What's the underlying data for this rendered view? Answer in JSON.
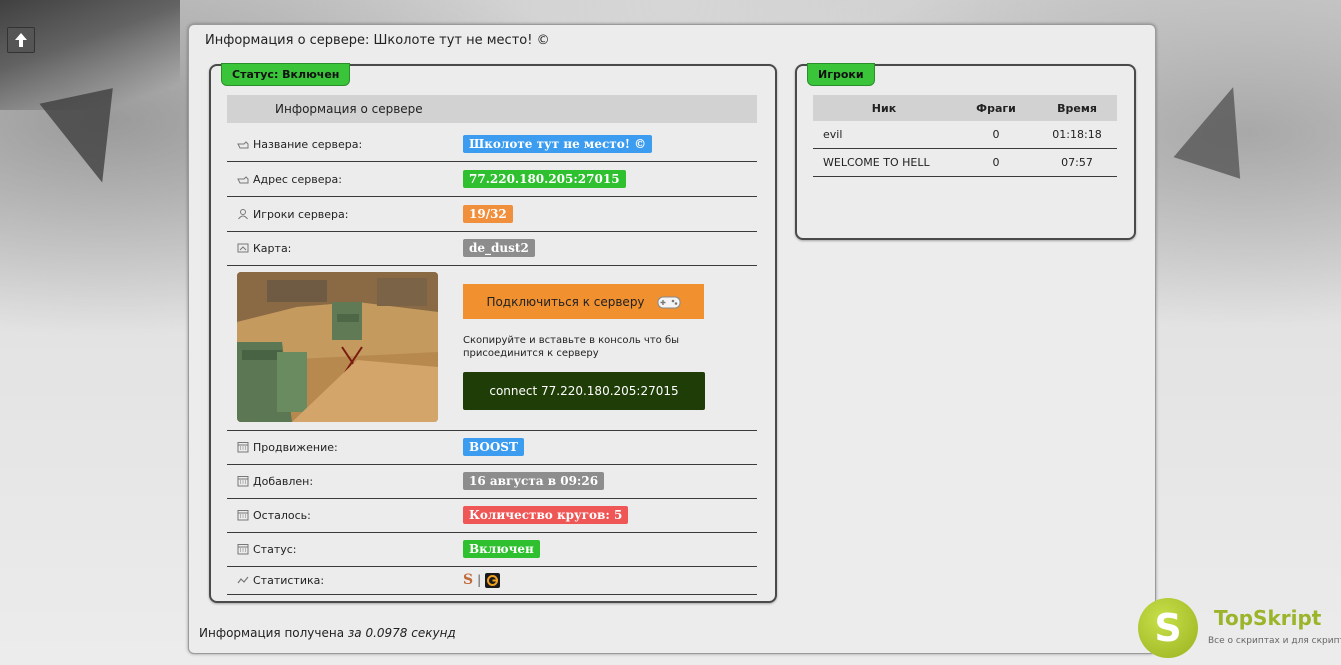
{
  "page_title": "Информация о сервере: Школоте тут не место! ©",
  "status_tab": "Статус: Включен",
  "players_tab": "Игроки",
  "info_header": "Информация о сервере",
  "rows": {
    "name": {
      "label": "Название сервера:",
      "value": "Школоте тут не место! ©"
    },
    "address": {
      "label": "Адрес сервера:",
      "value": "77.220.180.205:27015"
    },
    "players": {
      "label": "Игроки сервера:",
      "value": "19/32"
    },
    "map": {
      "label": "Карта:",
      "value": "de_dust2"
    },
    "promotion": {
      "label": "Продвижение:",
      "value": "BOOST"
    },
    "added": {
      "label": "Добавлен:",
      "value": "16 августа в 09:26"
    },
    "remaining": {
      "label": "Осталось:",
      "value": "Количество кругов: 5"
    },
    "status": {
      "label": "Статус:",
      "value": "Включен"
    },
    "stats": {
      "label": "Статистика:",
      "s_label": "S",
      "separator": "|"
    }
  },
  "connect": {
    "button_label": "Подключиться к серверу",
    "hint": "Скопируйте и вставьте в консоль что бы присоединится к серверу",
    "command": "connect 77.220.180.205:27015"
  },
  "players_table": {
    "headers": [
      "Ник",
      "Фраги",
      "Время"
    ],
    "rows": [
      {
        "nick": "evil",
        "frags": "0",
        "time": "01:18:18"
      },
      {
        "nick": "WELCOME TO HELL",
        "frags": "0",
        "time": "07:57"
      }
    ]
  },
  "footer": {
    "text": "Информация получена",
    "time": "за 0.0978 секунд"
  },
  "logo": {
    "letter": "S",
    "name": "TopSkript",
    "tagline": "Все о скриптах и для скриптов..."
  },
  "colors": {
    "green": "#2fc02f",
    "blue": "#3c9cf0",
    "orange": "#f0903c",
    "gray": "#8d8d8d",
    "red": "#ef5656",
    "connect_dark": "#1f3d06"
  }
}
